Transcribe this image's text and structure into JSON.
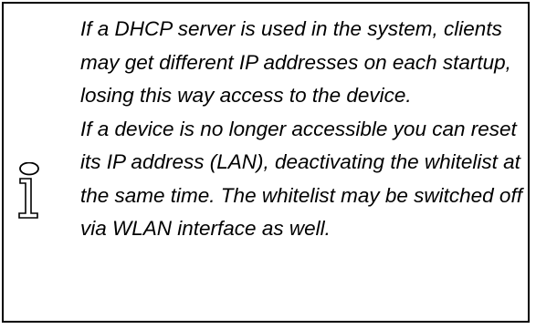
{
  "note": {
    "icon": "info-icon",
    "paragraphs": [
      "If a DHCP server is used in the system, clients may get different IP addresses on each startup, losing this way access to the device.",
      "If a device is no longer accessible you can reset its IP address (LAN), deactivating the whitelist at the same time. The whitelist may be switched off via WLAN interface as well."
    ]
  }
}
